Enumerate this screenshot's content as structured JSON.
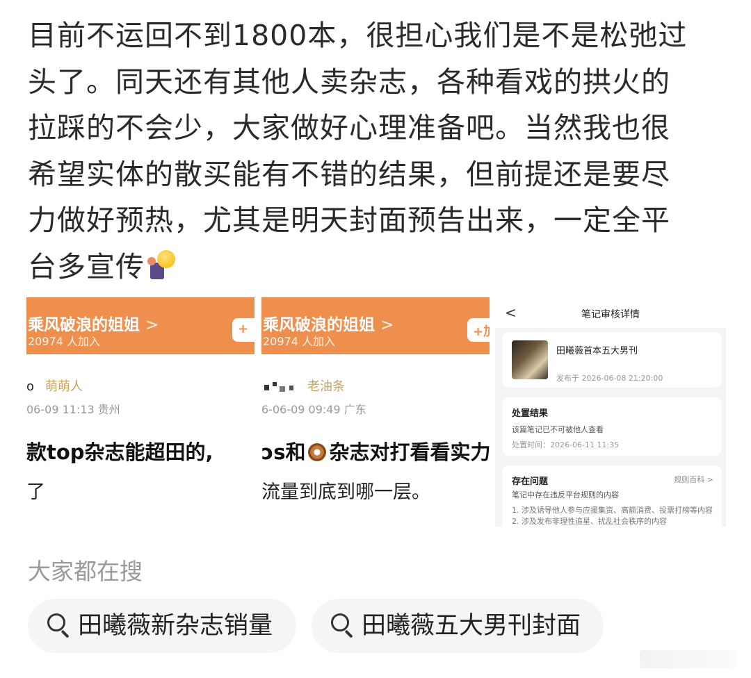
{
  "post": {
    "lines": [
      "目前不运回不到1800本，很担心我们是不是松弛过",
      "头了。同天还有其他人卖杂志，各种看戏的拱火的",
      "拉踩的不会少，大家做好心理准备吧。当然我也很",
      "希望实体的散买能有不错的结果，但前提还是要尽",
      "力做好预热，尤其是明天封面预告出来，一定全平",
      "台多宣传"
    ],
    "emoji": "person-with-lightbulb-emoji"
  },
  "shot1": {
    "banner_title": "乘风破浪的姐姐",
    "banner_chevron": ">",
    "banner_sub": "20974 人加入",
    "join_label": "+",
    "user_prefix": "o",
    "nickname": "萌萌人",
    "time": "06-09 11:13  贵州",
    "title": "款top杂志能超田的,",
    "line2": "了"
  },
  "shot2": {
    "banner_title": "乘风破浪的姐姐",
    "banner_chevron": ">",
    "banner_sub": "20974 人加入",
    "join_label": "+加",
    "nickname": "老油条",
    "time": "6-06-09 09:49  广东",
    "title_pre": "ɔs和",
    "title_post": "杂志对打看看实力",
    "line2": "流量到底到哪一层。"
  },
  "shot3": {
    "back": "<",
    "title": "笔记审核详情",
    "note_title": "田曦薇首本五大男刊",
    "note_time": "发布于 2026-06-08 21:20:00",
    "result_head": "处置结果",
    "result_line": "该篇笔记已不可被他人查看",
    "result_time": "处置时间：2026-06-11 11:35",
    "issue_head": "存在问题",
    "issue_link": "规则百科 >",
    "issue_desc": "笔记中存在违反平台规则的内容",
    "issue_1": "1. 涉及诱导他人参与应援集资、高额消费、投票打榜等内容",
    "issue_2": "2. 涉及发布非理性追星、扰乱社会秩序的内容"
  },
  "search": {
    "heading": "大家都在搜",
    "chips": [
      "田曦薇新杂志销量",
      "田曦薇五大男刊封面"
    ],
    "icon": "search-icon"
  },
  "colors": {
    "banner": "#ef8f4d",
    "nickname": "#c9a25a",
    "muted": "#9a9a9a",
    "chip_bg": "#f5f5f5"
  }
}
